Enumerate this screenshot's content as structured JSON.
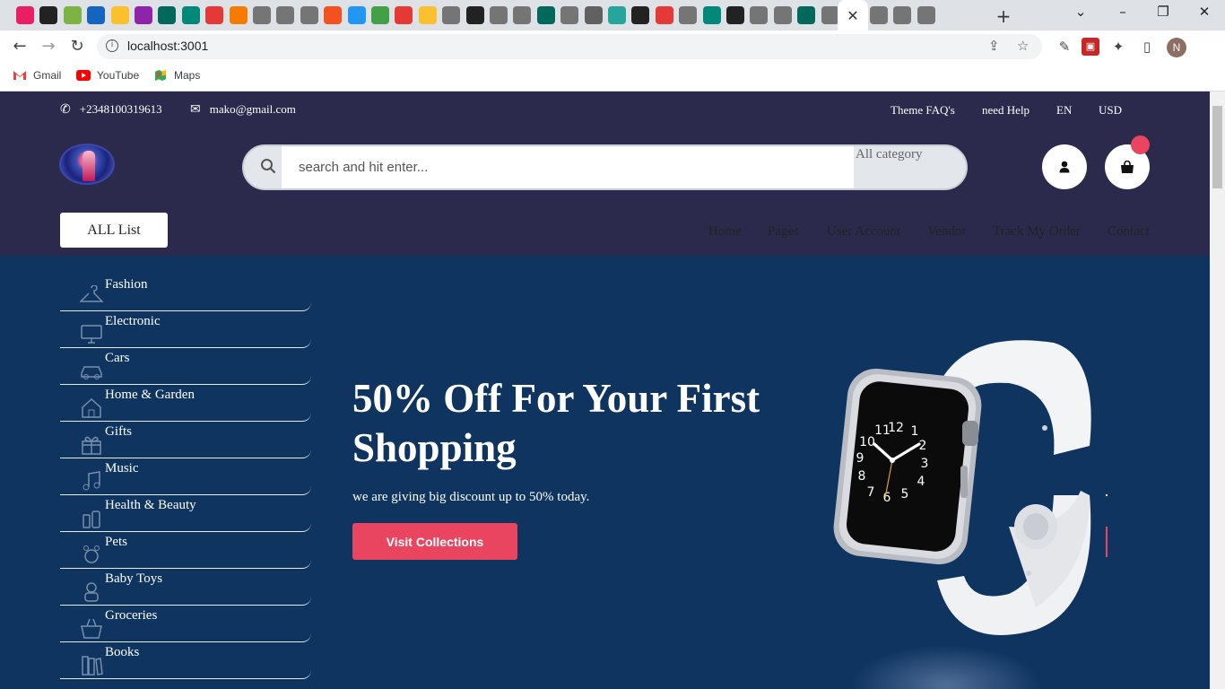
{
  "browser": {
    "active_tab_close": "✕",
    "new_tab": "+",
    "url": "localhost:3001",
    "bookmarks": [
      {
        "label": "Gmail"
      },
      {
        "label": "YouTube"
      },
      {
        "label": "Maps"
      }
    ],
    "profile_initial": "N",
    "tab_icon_colors": [
      "#e91e63",
      "#222222",
      "#7cb342",
      "#1565c0",
      "#fbc02d",
      "#8e24aa",
      "#00695c",
      "#00897b",
      "#e53935",
      "#f57c00",
      "#757575",
      "#757575",
      "#757575",
      "#f4511e",
      "#2196f3",
      "#43a047",
      "#e53935",
      "#fbc02d",
      "#757575",
      "#222222",
      "#757575",
      "#757575",
      "#00695c",
      "#757575",
      "#616161",
      "#26a69a",
      "#222222",
      "#e53935",
      "#757575",
      "#00897b",
      "#222222",
      "#757575",
      "#757575",
      "#00695c",
      "#757575",
      "#757575",
      "#757575",
      "#757575"
    ]
  },
  "topbar": {
    "phone": "+2348100319613",
    "email": "mako@gmail.com",
    "links": [
      "Theme FAQ's",
      "need Help",
      "EN",
      "USD"
    ]
  },
  "header": {
    "search_placeholder": "search and hit enter...",
    "category_select": "All category",
    "user_icon": "user-icon",
    "cart_icon": "shopping-bag-icon"
  },
  "nav": {
    "all_list": "ALL List",
    "menu": [
      "Home",
      "Pages",
      "User Account",
      "Vendor",
      "Track My Order",
      "Contact"
    ]
  },
  "categories": [
    {
      "label": "Fashion",
      "icon": "hanger-icon"
    },
    {
      "label": "Electronic",
      "icon": "monitor-icon"
    },
    {
      "label": "Cars",
      "icon": "car-icon"
    },
    {
      "label": "Home & Garden",
      "icon": "house-plant-icon"
    },
    {
      "label": "Gifts",
      "icon": "gift-icon"
    },
    {
      "label": "Music",
      "icon": "music-icon"
    },
    {
      "label": "Health & Beauty",
      "icon": "cosmetics-icon"
    },
    {
      "label": "Pets",
      "icon": "pet-icon"
    },
    {
      "label": "Baby Toys",
      "icon": "toy-icon"
    },
    {
      "label": "Groceries",
      "icon": "grocery-basket-icon"
    },
    {
      "label": "Books",
      "icon": "books-icon"
    }
  ],
  "hero": {
    "title": "50% Off For Your First Shopping",
    "subtitle": "we are giving big discount up to 50% today.",
    "button": "Visit Collections"
  },
  "colors": {
    "topbar_bg": "#2b2a4c",
    "hero_bg": "#0f3460",
    "accent": "#e94560"
  }
}
